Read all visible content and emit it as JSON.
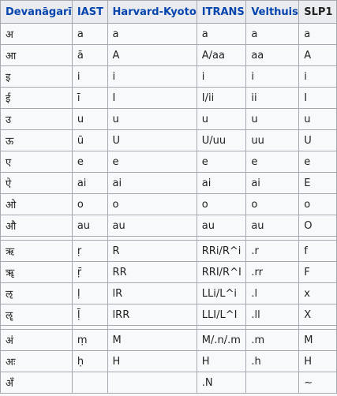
{
  "table": {
    "headers": [
      "Devanāgarī",
      "IAST",
      "Harvard-Kyoto",
      "ITRANS",
      "Velthuis",
      "SLP1"
    ],
    "groups": [
      [
        [
          "अ",
          "a",
          "a",
          "a",
          "a",
          "a"
        ],
        [
          "आ",
          "ā",
          "A",
          "A/aa",
          "aa",
          "A"
        ],
        [
          "इ",
          "i",
          "i",
          "i",
          "i",
          "i"
        ],
        [
          "ई",
          "ī",
          "I",
          "I/ii",
          "ii",
          "I"
        ],
        [
          "उ",
          "u",
          "u",
          "u",
          "u",
          "u"
        ],
        [
          "ऊ",
          "ū",
          "U",
          "U/uu",
          "uu",
          "U"
        ],
        [
          "ए",
          "e",
          "e",
          "e",
          "e",
          "e"
        ],
        [
          "ऐ",
          "ai",
          "ai",
          "ai",
          "ai",
          "E"
        ],
        [
          "ओ",
          "o",
          "o",
          "o",
          "o",
          "o"
        ],
        [
          "औ",
          "au",
          "au",
          "au",
          "au",
          "O"
        ]
      ],
      [
        [
          "ऋ",
          "ṛ",
          "R",
          "RRi/R^i",
          ".r",
          "f"
        ],
        [
          "ॠ",
          "ṝ",
          "RR",
          "RRI/R^I",
          ".rr",
          "F"
        ],
        [
          "ऌ",
          "ḷ",
          "lR",
          "LLi/L^i",
          ".l",
          "x"
        ],
        [
          "ॡ",
          "ḹ",
          "lRR",
          "LLI/L^I",
          ".ll",
          "X"
        ]
      ],
      [
        [
          "अं",
          "ṃ",
          "M",
          "M/.n/.m",
          ".m",
          "M"
        ],
        [
          "अः",
          "ḥ",
          "H",
          "H",
          ".h",
          "H"
        ],
        [
          "अँ",
          "",
          "",
          ".N",
          "",
          "~"
        ]
      ]
    ]
  }
}
